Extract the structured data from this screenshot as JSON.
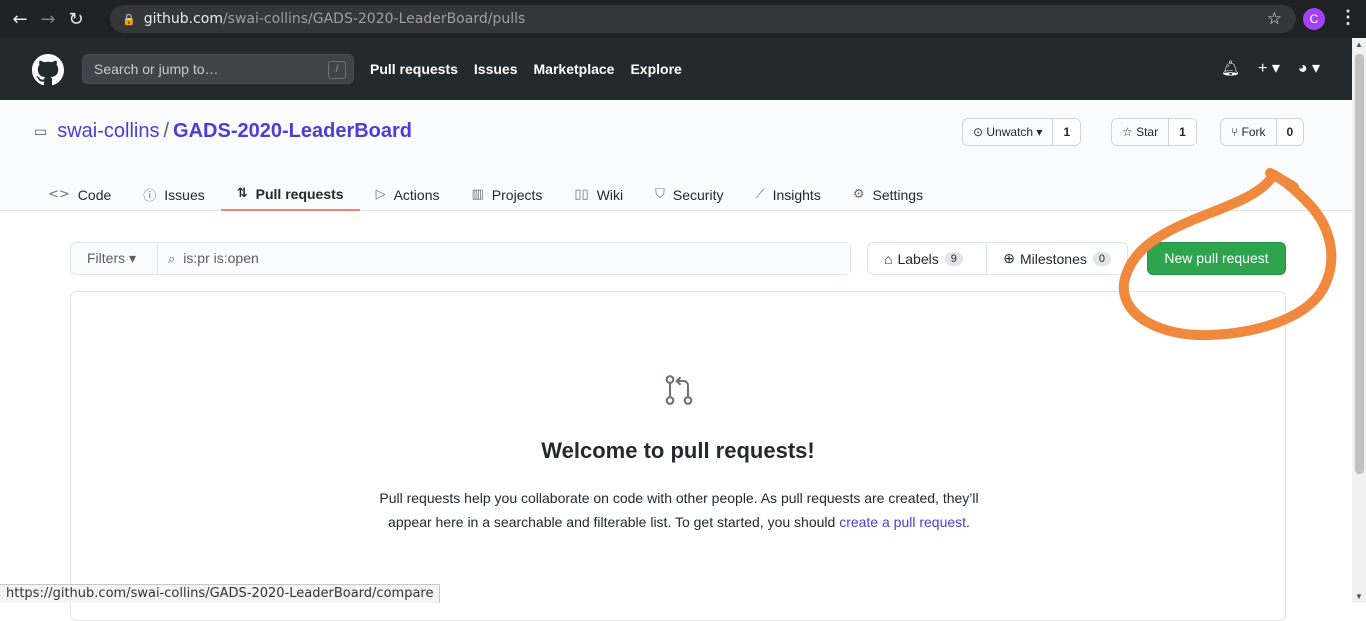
{
  "browser": {
    "url_host": "github.com",
    "url_path": "/swai-collins/GADS-2020-LeaderBoard/pulls",
    "profile_initial": "C",
    "status_url": "https://github.com/swai-collins/GADS-2020-LeaderBoard/compare"
  },
  "header": {
    "search_placeholder": "Search or jump to…",
    "search_shortcut": "/",
    "nav": [
      "Pull requests",
      "Issues",
      "Marketplace",
      "Explore"
    ]
  },
  "repo": {
    "owner": "swai-collins",
    "separator": "/",
    "name": "GADS-2020-LeaderBoard",
    "watch_label": "Unwatch",
    "watch_count": "1",
    "star_label": "Star",
    "star_count": "1",
    "fork_label": "Fork",
    "fork_count": "0"
  },
  "tabs": [
    {
      "label": "Code",
      "icon": "code-icon"
    },
    {
      "label": "Issues",
      "icon": "issue-icon"
    },
    {
      "label": "Pull requests",
      "icon": "pull-request-icon",
      "active": true
    },
    {
      "label": "Actions",
      "icon": "play-icon"
    },
    {
      "label": "Projects",
      "icon": "project-icon"
    },
    {
      "label": "Wiki",
      "icon": "book-icon"
    },
    {
      "label": "Security",
      "icon": "shield-icon"
    },
    {
      "label": "Insights",
      "icon": "graph-icon"
    },
    {
      "label": "Settings",
      "icon": "gear-icon"
    }
  ],
  "filters": {
    "button_label": "Filters",
    "query": "is:pr is:open",
    "labels_label": "Labels",
    "labels_count": "9",
    "milestones_label": "Milestones",
    "milestones_count": "0",
    "new_pr_label": "New pull request"
  },
  "blankslate": {
    "title": "Welcome to pull requests!",
    "text_line1": "Pull requests help you collaborate on code with other people. As pull requests are created, they’ll",
    "text_line2": "appear here in a searchable and filterable list. To get started, you should",
    "link": "create a pull request",
    "period": "."
  },
  "colors": {
    "accent_green": "#2ea44f",
    "annotation": "#f0883e",
    "link": "#4a3ed6"
  }
}
